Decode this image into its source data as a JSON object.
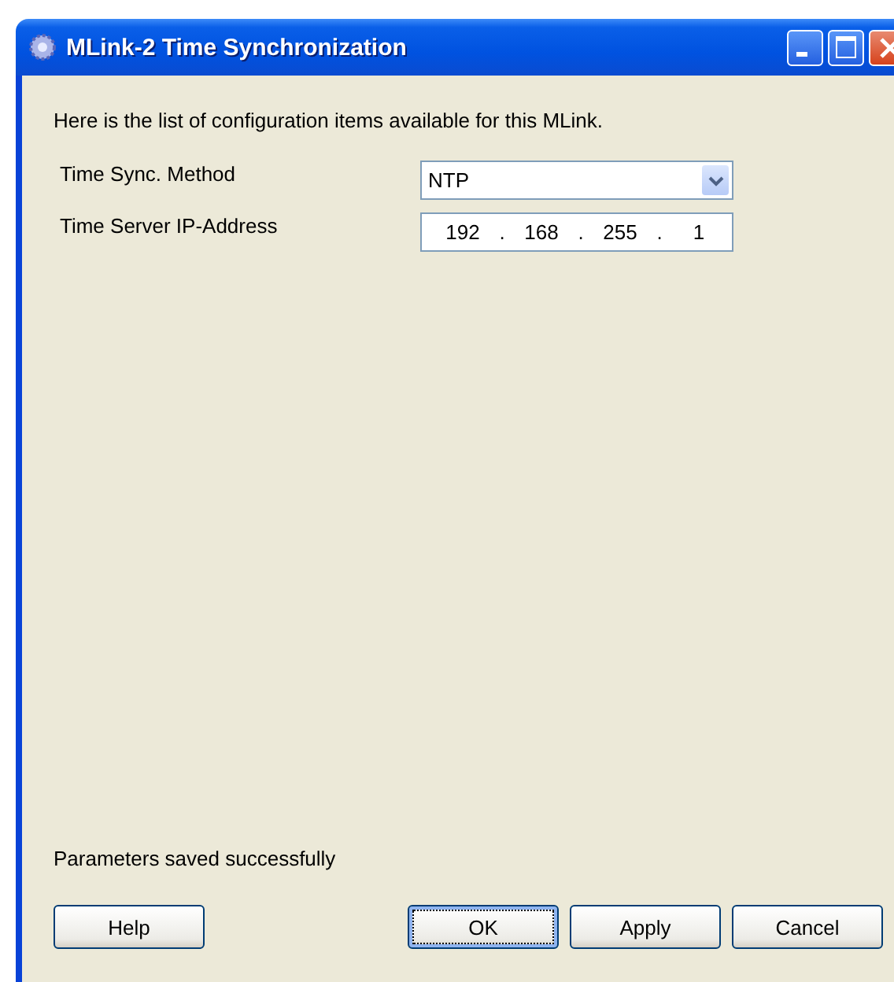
{
  "window": {
    "title": "MLink-2 Time Synchronization"
  },
  "description": "Here is the list of configuration items available for this MLink.",
  "fields": [
    {
      "kind": "dropdown",
      "label": "Time Sync. Method",
      "value": "NTP"
    },
    {
      "kind": "ip",
      "label": "Time Server IP-Address",
      "octets": [
        "192",
        "168",
        "255",
        "1"
      ],
      "separator": "."
    }
  ],
  "status": "Parameters saved successfully",
  "buttons": [
    {
      "label": "Help",
      "focused": false
    },
    {
      "label": "OK",
      "focused": true
    },
    {
      "label": "Apply",
      "focused": false
    },
    {
      "label": "Cancel",
      "focused": false
    }
  ]
}
